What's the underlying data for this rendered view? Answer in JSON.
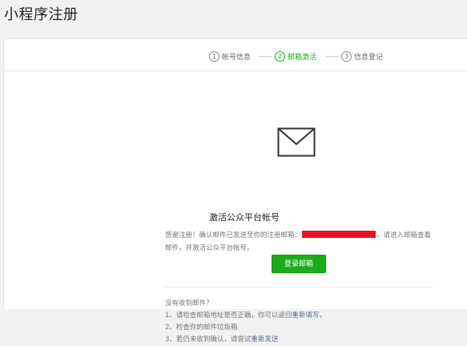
{
  "header": {
    "title": "小程序注册"
  },
  "steps": [
    {
      "num": "1",
      "label": "帐号信息"
    },
    {
      "num": "2",
      "label": "邮箱激活"
    },
    {
      "num": "3",
      "label": "信息登记"
    }
  ],
  "active_step": 2,
  "colors": {
    "accent": "#1aad19",
    "link": "#576b95",
    "redaction": "#e8141e"
  },
  "main": {
    "icon": "mail-envelope-icon",
    "heading": "激活公众平台帐号",
    "message_prefix": "感谢注册！确认邮件已发送至你的注册邮箱：",
    "message_suffix": "。请进入邮箱查看邮件，并激活公众平台帐号。",
    "login_button": "登录邮箱"
  },
  "help": {
    "question": "没有收到邮件？",
    "item1_prefix": "1、请检查邮箱地址是否正确，你可以返回",
    "item1_link": "重新填写",
    "item1_suffix": "。",
    "item2": "2、检查你的邮件垃圾箱",
    "item3_prefix": "3、若仍未收到确认，请尝试",
    "item3_link": "重新发送"
  }
}
